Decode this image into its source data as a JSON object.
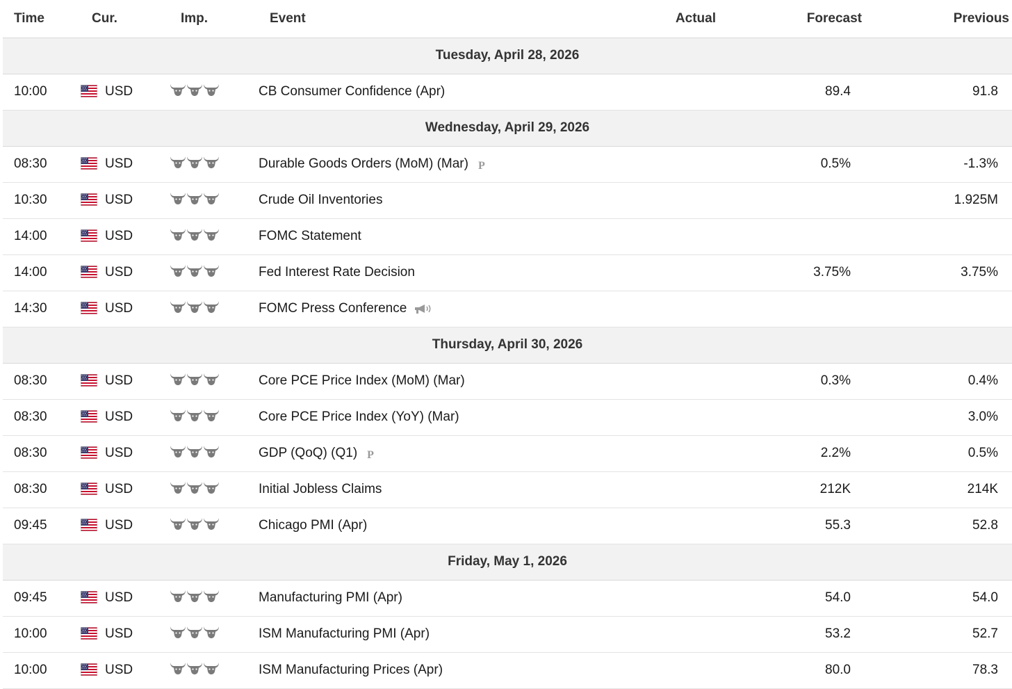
{
  "headers": {
    "time": "Time",
    "currency": "Cur.",
    "importance": "Imp.",
    "event": "Event",
    "actual": "Actual",
    "forecast": "Forecast",
    "previous": "Previous"
  },
  "colors": {
    "day_row_bg": "#f2f2f2",
    "border": "#d9d9d9",
    "bull_icon": "#7a7a7a",
    "marker": "#9a9a9a"
  },
  "days": [
    {
      "label": "Tuesday, April 28, 2026",
      "events": [
        {
          "time": "10:00",
          "currency": "USD",
          "flag": "us-flag-icon",
          "importance": 3,
          "event": "CB Consumer Confidence (Apr)",
          "marker": null,
          "actual": "",
          "forecast": "89.4",
          "previous": "91.8"
        }
      ]
    },
    {
      "label": "Wednesday, April 29, 2026",
      "events": [
        {
          "time": "08:30",
          "currency": "USD",
          "flag": "us-flag-icon",
          "importance": 3,
          "event": "Durable Goods Orders (MoM) (Mar)",
          "marker": "P",
          "actual": "",
          "forecast": "0.5%",
          "previous": "-1.3%"
        },
        {
          "time": "10:30",
          "currency": "USD",
          "flag": "us-flag-icon",
          "importance": 3,
          "event": "Crude Oil Inventories",
          "marker": null,
          "actual": "",
          "forecast": "",
          "previous": "1.925M"
        },
        {
          "time": "14:00",
          "currency": "USD",
          "flag": "us-flag-icon",
          "importance": 3,
          "event": "FOMC Statement",
          "marker": null,
          "actual": "",
          "forecast": "",
          "previous": ""
        },
        {
          "time": "14:00",
          "currency": "USD",
          "flag": "us-flag-icon",
          "importance": 3,
          "event": "Fed Interest Rate Decision",
          "marker": null,
          "actual": "",
          "forecast": "3.75%",
          "previous": "3.75%"
        },
        {
          "time": "14:30",
          "currency": "USD",
          "flag": "us-flag-icon",
          "importance": 3,
          "event": "FOMC Press Conference",
          "marker": "speech",
          "actual": "",
          "forecast": "",
          "previous": ""
        }
      ]
    },
    {
      "label": "Thursday, April 30, 2026",
      "events": [
        {
          "time": "08:30",
          "currency": "USD",
          "flag": "us-flag-icon",
          "importance": 3,
          "event": "Core PCE Price Index (MoM) (Mar)",
          "marker": null,
          "actual": "",
          "forecast": "0.3%",
          "previous": "0.4%"
        },
        {
          "time": "08:30",
          "currency": "USD",
          "flag": "us-flag-icon",
          "importance": 3,
          "event": "Core PCE Price Index (YoY) (Mar)",
          "marker": null,
          "actual": "",
          "forecast": "",
          "previous": "3.0%"
        },
        {
          "time": "08:30",
          "currency": "USD",
          "flag": "us-flag-icon",
          "importance": 3,
          "event": "GDP (QoQ) (Q1)",
          "marker": "P",
          "actual": "",
          "forecast": "2.2%",
          "previous": "0.5%"
        },
        {
          "time": "08:30",
          "currency": "USD",
          "flag": "us-flag-icon",
          "importance": 3,
          "event": "Initial Jobless Claims",
          "marker": null,
          "actual": "",
          "forecast": "212K",
          "previous": "214K"
        },
        {
          "time": "09:45",
          "currency": "USD",
          "flag": "us-flag-icon",
          "importance": 3,
          "event": "Chicago PMI (Apr)",
          "marker": null,
          "actual": "",
          "forecast": "55.3",
          "previous": "52.8"
        }
      ]
    },
    {
      "label": "Friday, May 1, 2026",
      "events": [
        {
          "time": "09:45",
          "currency": "USD",
          "flag": "us-flag-icon",
          "importance": 3,
          "event": "Manufacturing PMI (Apr)",
          "marker": null,
          "actual": "",
          "forecast": "54.0",
          "previous": "54.0"
        },
        {
          "time": "10:00",
          "currency": "USD",
          "flag": "us-flag-icon",
          "importance": 3,
          "event": "ISM Manufacturing PMI (Apr)",
          "marker": null,
          "actual": "",
          "forecast": "53.2",
          "previous": "52.7"
        },
        {
          "time": "10:00",
          "currency": "USD",
          "flag": "us-flag-icon",
          "importance": 3,
          "event": "ISM Manufacturing Prices (Apr)",
          "marker": null,
          "actual": "",
          "forecast": "80.0",
          "previous": "78.3"
        }
      ]
    }
  ]
}
